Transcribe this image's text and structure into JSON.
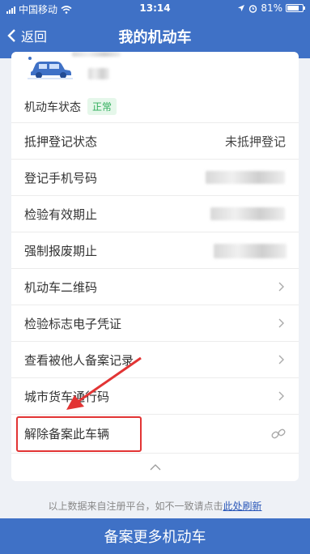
{
  "status_bar": {
    "carrier": "中国移动",
    "time": "13:14",
    "battery": "81%"
  },
  "nav": {
    "back_label": "返回",
    "title": "我的机动车"
  },
  "vehicle": {
    "state_label": "机动车状态",
    "state_badge": "正常"
  },
  "rows": [
    {
      "label": "抵押登记状态",
      "value": "未抵押登记"
    },
    {
      "label": "登记手机号码",
      "value": ""
    },
    {
      "label": "检验有效期止",
      "value": ""
    },
    {
      "label": "强制报废期止",
      "value": ""
    },
    {
      "label": "机动车二维码"
    },
    {
      "label": "检验标志电子凭证"
    },
    {
      "label": "查看被他人备案记录"
    },
    {
      "label": "城市货车通行码"
    },
    {
      "label": "解除备案此车辆"
    }
  ],
  "footer": {
    "note": "以上数据来自注册平台，如不一致请点击",
    "refresh_link": "此处刷新"
  },
  "bottom_button": "备案更多机动车",
  "colors": {
    "brand": "#3f71c6",
    "badge_green": "#2fae5b",
    "highlight_red": "#e23434"
  }
}
